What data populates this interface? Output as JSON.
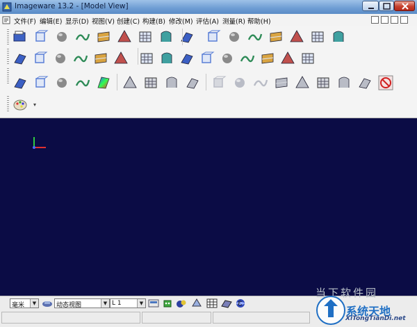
{
  "window": {
    "title": "Imageware 13.2  - [Model View]"
  },
  "menu": {
    "items": [
      {
        "label": "文件(F)"
      },
      {
        "label": "编辑(E)"
      },
      {
        "label": "显示(D)"
      },
      {
        "label": "视图(V)"
      },
      {
        "label": "创建(C)"
      },
      {
        "label": "构建(B)"
      },
      {
        "label": "修改(M)"
      },
      {
        "label": "评估(A)"
      },
      {
        "label": "测量(R)"
      },
      {
        "label": "帮助(H)"
      }
    ]
  },
  "toolbar": {
    "row1": [
      "open-file-icon",
      "zoom-search-icon",
      "cube-view-icon",
      "wireframe-cube-icon",
      "cloud-grid-icon",
      "pyramid-mesh-icon",
      "bowl-surface-icon",
      "curved-surface-icon",
      "twisted-surface-icon",
      "blend-surface-icon",
      "arch-surface-icon",
      "tube-surface-icon",
      "shell-surface-icon",
      "sheet-fold-icon",
      "extrude-surface-icon",
      "tetrahedron-icon"
    ],
    "row2": [
      "box-points-icon",
      "section-plane-icon",
      "point-cloud-icon",
      "sphere-point-icon",
      "plane-cross-icon",
      "coordinate-icon",
      "curve-surface-icon",
      "layer-stack-icon",
      "surface-normal-icon",
      "tilted-surface-icon",
      "corner-surface-icon",
      "fold-sheet-icon",
      "patch-grid-icon",
      "bulb-probe-icon",
      "grid-patch-icon"
    ],
    "row3": [
      "eye-display-icon",
      "cylinder-icon",
      "plate-icon",
      "plane-flat-icon",
      "color-map-icon",
      "cloud-faded-icon",
      "curve-faded-icon",
      "sweep-faded-icon",
      "fan-faded-icon",
      "mesh-faded-icon",
      "lightning-icon",
      "snake-curve-icon",
      "tangent-icon",
      "target-icon",
      "spiral-icon",
      "flag-icon",
      "cross-cut-icon",
      "delete-no-icon"
    ],
    "row4": [
      "palette-icon"
    ]
  },
  "status": {
    "units": "毫米",
    "view_mode": "动态视图",
    "layer": "L 1",
    "epsilon_symbol": "ε"
  },
  "colors": {
    "viewport_bg": "#0b0c45",
    "title_bar": "#6d9cd3"
  },
  "watermark": {
    "faint_text": "当下软件园",
    "brand": "系统天地",
    "url": "XiTongTianDi.net"
  }
}
